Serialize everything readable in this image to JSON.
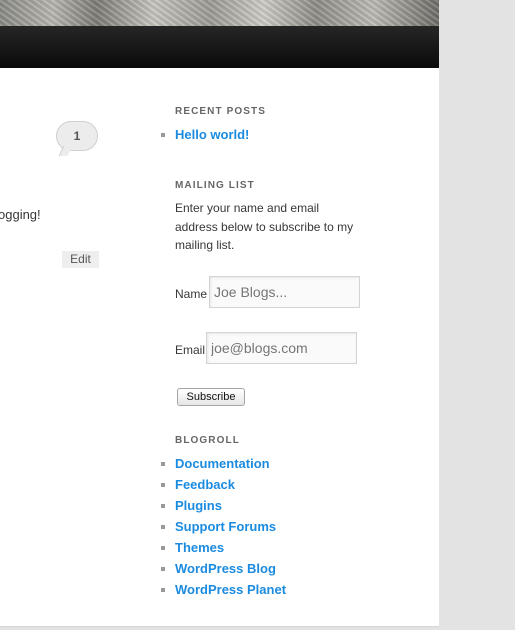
{
  "colors": {
    "link": "#1b8be0",
    "navbar": "#111111",
    "background": "#e3e3e3"
  },
  "post": {
    "comment_count": "1",
    "text_fragment": "ogging!",
    "edit_label": "Edit"
  },
  "recent_posts": {
    "title": "RECENT POSTS",
    "items": [
      "Hello world!"
    ]
  },
  "mailing_list": {
    "title": "MAILING LIST",
    "description": "Enter your name and email address below to subscribe to my mailing list.",
    "name_label": "Name",
    "name_placeholder": "Joe Blogs...",
    "email_label": "Email",
    "email_placeholder": "joe@blogs.com",
    "subscribe_label": "Subscribe"
  },
  "blogroll": {
    "title": "BLOGROLL",
    "items": [
      "Documentation",
      "Feedback",
      "Plugins",
      "Support Forums",
      "Themes",
      "WordPress Blog",
      "WordPress Planet"
    ]
  }
}
